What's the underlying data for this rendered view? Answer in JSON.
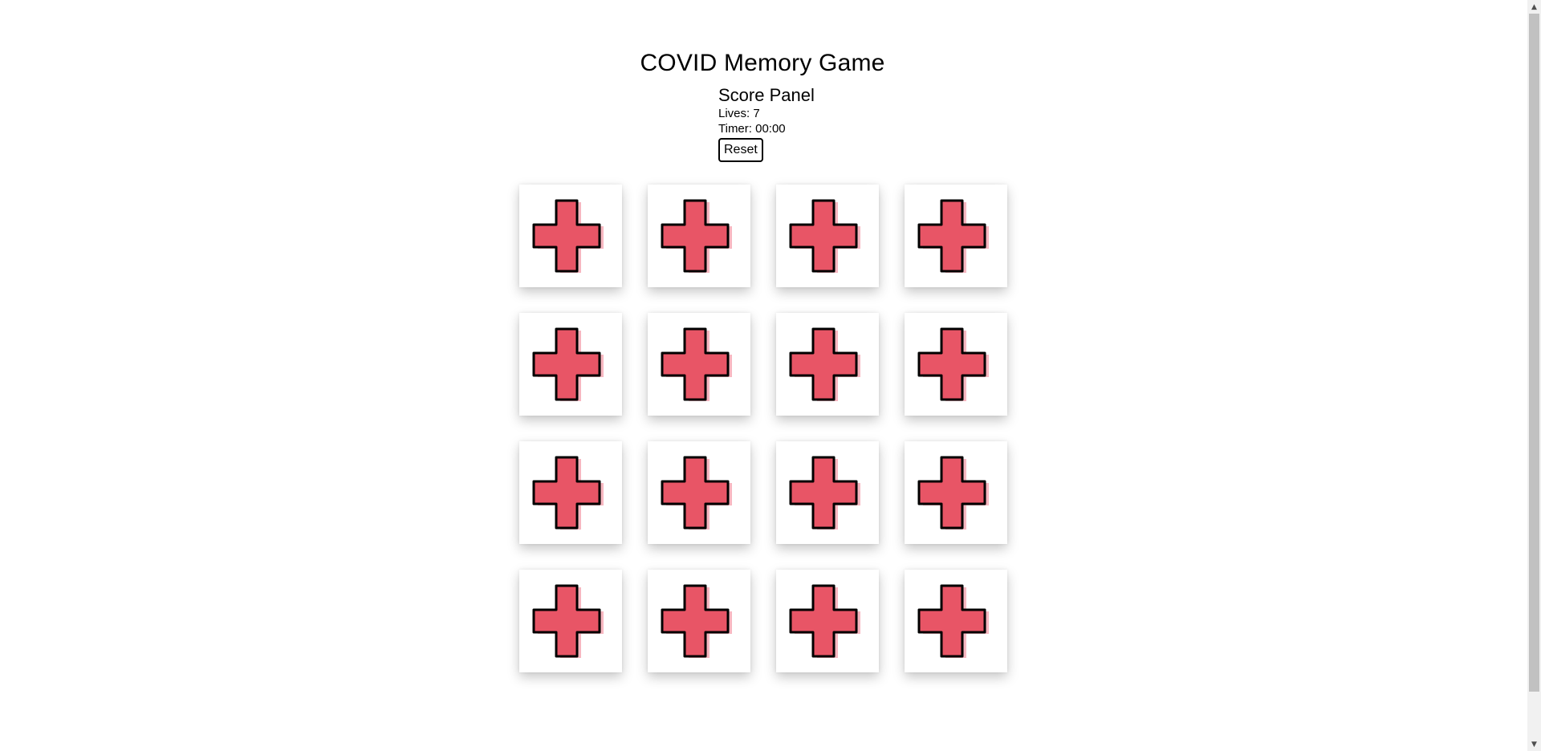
{
  "game": {
    "title": "COVID Memory Game"
  },
  "score_panel": {
    "heading": "Score Panel",
    "lives_text": "Lives: 7",
    "timer_text": "Timer: 00:00",
    "reset_label": "Reset"
  },
  "board": {
    "rows": 4,
    "columns": 4,
    "card_back_icon": "medical-cross-icon",
    "cards_face_down": 16
  },
  "colors": {
    "cross_fill": "#e85566",
    "cross_shadow": "#f7b7c1",
    "cross_outline": "#000000",
    "card_background": "#ffffff"
  },
  "scrollbar": {
    "up_arrow": "▲",
    "down_arrow": "▼"
  }
}
